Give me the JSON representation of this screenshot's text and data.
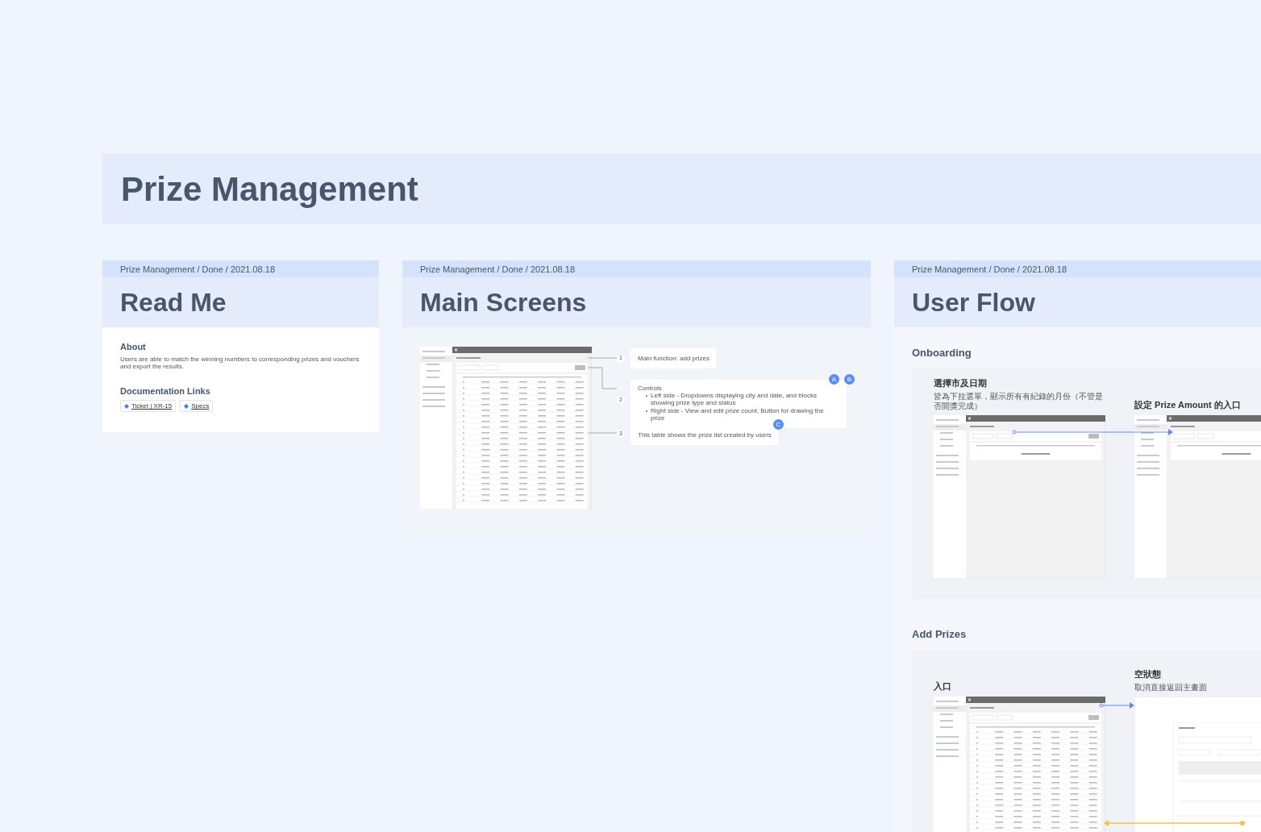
{
  "page_title": "Prize Management",
  "read_me": {
    "breadcrumb": "Prize Management / Done / 2021.08.18",
    "title": "Read Me",
    "about": {
      "heading": "About",
      "text": "Users are able to match the winning numbers to corresponding prizes and vouchers and export the results."
    },
    "links": {
      "heading": "Documentation Links",
      "items": [
        "Ticket | XR-15",
        "Specs"
      ]
    }
  },
  "main_screens": {
    "breadcrumb": "Prize Management / Done / 2021.08.18",
    "title": "Main Screens",
    "callouts": [
      {
        "number": "1",
        "text": "Main function: add prizes"
      },
      {
        "number": "2",
        "text": "Controls",
        "bullets": [
          "Left side - Dropdowns displaying city and date, and blocks showing prize type and status",
          "Right side - View and edit prize count, Button for drawing the prize"
        ],
        "badges": [
          "A",
          "B"
        ]
      },
      {
        "number": "3",
        "text": "This table shows the prize list created by users",
        "badges": [
          "C"
        ]
      }
    ]
  },
  "user_flow": {
    "breadcrumb": "Prize Management / Done / 2021.08.18",
    "title": "User Flow",
    "sections": [
      {
        "heading": "Onboarding",
        "steps": [
          {
            "title": "選擇市及日期",
            "note": "皆為下拉選單，顯示所有有紀錄的月份（不管是否開獎完成）",
            "kind": "empty-table"
          },
          {
            "title": "設定 Prize Amount 的入口",
            "kind": "empty-table"
          }
        ]
      },
      {
        "heading": "Add Prizes",
        "steps": [
          {
            "title": "入口",
            "kind": "table"
          },
          {
            "title": "空狀態",
            "note": "取消直接返回主畫面",
            "kind": "dialog"
          }
        ]
      }
    ]
  }
}
